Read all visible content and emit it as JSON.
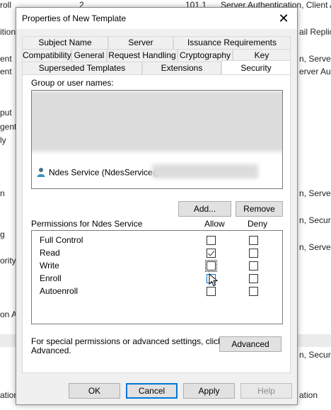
{
  "background": {
    "rows": [
      {
        "left": "roll",
        "num": "2",
        "ver": "101.1",
        "right": "Server Authentication, Client A"
      },
      {
        "left": "ition",
        "right": "ail Replic"
      },
      {
        "left": "ent",
        "right": "n, Server A"
      },
      {
        "left": "ent",
        "right": "erver Aut"
      },
      {
        "left": "put",
        "right": ""
      },
      {
        "left": "gent",
        "right": ""
      },
      {
        "left": "ly",
        "right": ""
      },
      {
        "left": "n",
        "right": "n, Server A"
      },
      {
        "left": "",
        "right": "n, Secure"
      },
      {
        "left": "g",
        "right": ""
      },
      {
        "left": "ority",
        "right": "n, Server A"
      },
      {
        "left": "on A",
        "right": ""
      },
      {
        "left": "",
        "right": "n, Secure"
      },
      {
        "left": "ation",
        "right": "ation"
      }
    ]
  },
  "dialog": {
    "title": "Properties of New Template",
    "close_glyph": "✕"
  },
  "tabs": {
    "row1": [
      "Subject Name",
      "Server",
      "Issuance Requirements"
    ],
    "row2": [
      "Compatibility",
      "General",
      "Request Handling",
      "Cryptography",
      "Key Attestation"
    ],
    "row3": [
      "Superseded Templates",
      "Extensions",
      "Security"
    ],
    "active": "Security"
  },
  "security": {
    "group_label": "Group or user names:",
    "selected_user": "Ndes Service (NdesService@",
    "add_button": "Add...",
    "remove_button": "Remove",
    "permissions_label": "Permissions for Ndes Service",
    "allow_header": "Allow",
    "deny_header": "Deny",
    "permissions": [
      {
        "name": "Full Control",
        "allow": false,
        "deny": false
      },
      {
        "name": "Read",
        "allow": true,
        "deny": false
      },
      {
        "name": "Write",
        "allow": false,
        "deny": false
      },
      {
        "name": "Enroll",
        "allow": false,
        "deny": false
      },
      {
        "name": "Autoenroll",
        "allow": false,
        "deny": false
      }
    ],
    "special_text_line1": "For special permissions or advanced settings, click",
    "special_text_line2": "Advanced.",
    "advanced_button": "Advanced"
  },
  "footer": {
    "ok": "OK",
    "cancel": "Cancel",
    "apply": "Apply",
    "help": "Help"
  }
}
